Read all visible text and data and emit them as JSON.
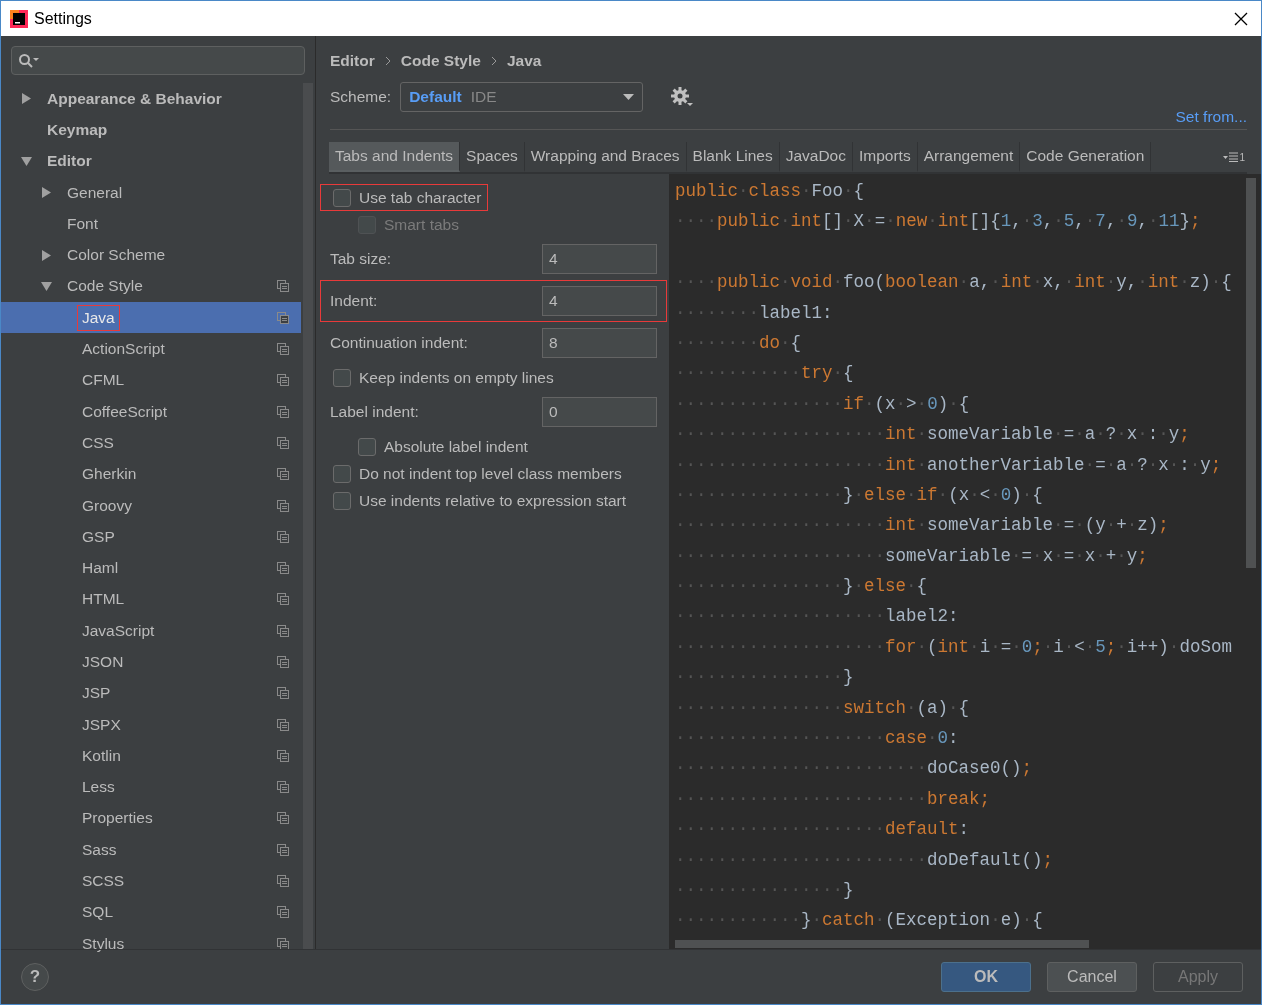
{
  "window": {
    "title": "Settings"
  },
  "sidebar": {
    "tree": [
      {
        "label": "Appearance & Behavior",
        "expanded": false,
        "selected": false
      },
      {
        "label": "Keymap",
        "selected": false
      },
      {
        "label": "Editor",
        "expanded": true,
        "selected": false,
        "children": [
          {
            "label": "General",
            "expanded": false,
            "selected": false,
            "copy_icon": false
          },
          {
            "label": "Font",
            "selected": false,
            "copy_icon": false
          },
          {
            "label": "Color Scheme",
            "expanded": false,
            "selected": false,
            "copy_icon": false
          },
          {
            "label": "Code Style",
            "expanded": true,
            "selected": false,
            "copy_icon": true,
            "children": [
              {
                "label": "Java",
                "selected": true,
                "copy_icon": true,
                "highlighted": true
              },
              {
                "label": "ActionScript",
                "selected": false,
                "copy_icon": true,
                "highlighted": false
              },
              {
                "label": "CFML",
                "selected": false,
                "copy_icon": true,
                "highlighted": false
              },
              {
                "label": "CoffeeScript",
                "selected": false,
                "copy_icon": true,
                "highlighted": false
              },
              {
                "label": "CSS",
                "selected": false,
                "copy_icon": true,
                "highlighted": false
              },
              {
                "label": "Gherkin",
                "selected": false,
                "copy_icon": true,
                "highlighted": false
              },
              {
                "label": "Groovy",
                "selected": false,
                "copy_icon": true,
                "highlighted": false
              },
              {
                "label": "GSP",
                "selected": false,
                "copy_icon": true,
                "highlighted": false
              },
              {
                "label": "Haml",
                "selected": false,
                "copy_icon": true,
                "highlighted": false
              },
              {
                "label": "HTML",
                "selected": false,
                "copy_icon": true,
                "highlighted": false
              },
              {
                "label": "JavaScript",
                "selected": false,
                "copy_icon": true,
                "highlighted": false
              },
              {
                "label": "JSON",
                "selected": false,
                "copy_icon": true,
                "highlighted": false
              },
              {
                "label": "JSP",
                "selected": false,
                "copy_icon": true,
                "highlighted": false
              },
              {
                "label": "JSPX",
                "selected": false,
                "copy_icon": true,
                "highlighted": false
              },
              {
                "label": "Kotlin",
                "selected": false,
                "copy_icon": true,
                "highlighted": false
              },
              {
                "label": "Less",
                "selected": false,
                "copy_icon": true,
                "highlighted": false
              },
              {
                "label": "Properties",
                "selected": false,
                "copy_icon": true,
                "highlighted": false
              },
              {
                "label": "Sass",
                "selected": false,
                "copy_icon": true,
                "highlighted": false
              },
              {
                "label": "SCSS",
                "selected": false,
                "copy_icon": true,
                "highlighted": false
              },
              {
                "label": "SQL",
                "selected": false,
                "copy_icon": true,
                "highlighted": false
              },
              {
                "label": "Stylus",
                "selected": false,
                "copy_icon": true,
                "highlighted": false
              }
            ]
          }
        ]
      }
    ]
  },
  "breadcrumb": [
    "Editor",
    "Code Style",
    "Java"
  ],
  "scheme": {
    "label": "Scheme:",
    "name": "Default",
    "type": "IDE"
  },
  "set_from": "Set from...",
  "tabs": [
    {
      "label": "Tabs and Indents",
      "selected": true
    },
    {
      "label": "Spaces",
      "selected": false
    },
    {
      "label": "Wrapping and Braces",
      "selected": false
    },
    {
      "label": "Blank Lines",
      "selected": false
    },
    {
      "label": "JavaDoc",
      "selected": false
    },
    {
      "label": "Imports",
      "selected": false
    },
    {
      "label": "Arrangement",
      "selected": false
    },
    {
      "label": "Code Generation",
      "selected": false
    }
  ],
  "tabs_overflow_count": "1",
  "options": [
    {
      "kind": "checkbox",
      "label": "Use tab character",
      "checked": false,
      "disabled": false,
      "nested": false,
      "highlighted": true
    },
    {
      "kind": "checkbox",
      "label": "Smart tabs",
      "checked": false,
      "disabled": true,
      "nested": true,
      "highlighted": false
    },
    {
      "kind": "number",
      "label": "Tab size:",
      "value": "4",
      "highlighted": false
    },
    {
      "kind": "number",
      "label": "Indent:",
      "value": "4",
      "highlighted": true
    },
    {
      "kind": "number",
      "label": "Continuation indent:",
      "value": "8",
      "highlighted": false
    },
    {
      "kind": "checkbox",
      "label": "Keep indents on empty lines",
      "checked": false,
      "disabled": false,
      "nested": false,
      "highlighted": false
    },
    {
      "kind": "number",
      "label": "Label indent:",
      "value": "0",
      "highlighted": false
    },
    {
      "kind": "checkbox",
      "label": "Absolute label indent",
      "checked": false,
      "disabled": false,
      "nested": true,
      "highlighted": false
    },
    {
      "kind": "checkbox",
      "label": "Do not indent top level class members",
      "checked": false,
      "disabled": false,
      "nested": false,
      "highlighted": false
    },
    {
      "kind": "checkbox",
      "label": "Use indents relative to expression start",
      "checked": false,
      "disabled": false,
      "nested": false,
      "highlighted": false
    }
  ],
  "code_preview": [
    {
      "kind": "code",
      "tokens": [
        {
          "kind": "keyword",
          "text": "public"
        },
        {
          "kind": "space",
          "text": "·"
        },
        {
          "kind": "keyword",
          "text": "class"
        },
        {
          "kind": "space",
          "text": "·"
        },
        {
          "kind": "plain",
          "text": "Foo"
        },
        {
          "kind": "space",
          "text": "·"
        },
        {
          "kind": "plain",
          "text": "{"
        }
      ]
    },
    {
      "kind": "code",
      "tokens": [
        {
          "kind": "space",
          "text": "····"
        },
        {
          "kind": "keyword",
          "text": "public"
        },
        {
          "kind": "space",
          "text": "·"
        },
        {
          "kind": "keyword",
          "text": "int"
        },
        {
          "kind": "plain",
          "text": "[]"
        },
        {
          "kind": "space",
          "text": "·"
        },
        {
          "kind": "plain",
          "text": "X"
        },
        {
          "kind": "space",
          "text": "·"
        },
        {
          "kind": "plain",
          "text": "="
        },
        {
          "kind": "space",
          "text": "·"
        },
        {
          "kind": "keyword",
          "text": "new"
        },
        {
          "kind": "space",
          "text": "·"
        },
        {
          "kind": "keyword",
          "text": "int"
        },
        {
          "kind": "plain",
          "text": "[]{"
        },
        {
          "kind": "number",
          "text": "1"
        },
        {
          "kind": "plain",
          "text": ","
        },
        {
          "kind": "space",
          "text": "·"
        },
        {
          "kind": "number",
          "text": "3"
        },
        {
          "kind": "plain",
          "text": ","
        },
        {
          "kind": "space",
          "text": "·"
        },
        {
          "kind": "number",
          "text": "5"
        },
        {
          "kind": "plain",
          "text": ","
        },
        {
          "kind": "space",
          "text": "·"
        },
        {
          "kind": "number",
          "text": "7"
        },
        {
          "kind": "plain",
          "text": ","
        },
        {
          "kind": "space",
          "text": "·"
        },
        {
          "kind": "number",
          "text": "9"
        },
        {
          "kind": "plain",
          "text": ","
        },
        {
          "kind": "space",
          "text": "·"
        },
        {
          "kind": "number",
          "text": "11"
        },
        {
          "kind": "plain",
          "text": "}"
        },
        {
          "kind": "keyword",
          "text": ";"
        }
      ]
    },
    {
      "kind": "blank"
    },
    {
      "kind": "code",
      "tokens": [
        {
          "kind": "space",
          "text": "····"
        },
        {
          "kind": "keyword",
          "text": "public"
        },
        {
          "kind": "space",
          "text": "·"
        },
        {
          "kind": "keyword",
          "text": "void"
        },
        {
          "kind": "space",
          "text": "·"
        },
        {
          "kind": "plain",
          "text": "foo("
        },
        {
          "kind": "keyword",
          "text": "boolean"
        },
        {
          "kind": "space",
          "text": "·"
        },
        {
          "kind": "plain",
          "text": "a,"
        },
        {
          "kind": "space",
          "text": "·"
        },
        {
          "kind": "keyword",
          "text": "int"
        },
        {
          "kind": "space",
          "text": "·"
        },
        {
          "kind": "plain",
          "text": "x,"
        },
        {
          "kind": "space",
          "text": "·"
        },
        {
          "kind": "keyword",
          "text": "int"
        },
        {
          "kind": "space",
          "text": "·"
        },
        {
          "kind": "plain",
          "text": "y,"
        },
        {
          "kind": "space",
          "text": "·"
        },
        {
          "kind": "keyword",
          "text": "int"
        },
        {
          "kind": "space",
          "text": "·"
        },
        {
          "kind": "plain",
          "text": "z)"
        },
        {
          "kind": "space",
          "text": "·"
        },
        {
          "kind": "plain",
          "text": "{"
        }
      ]
    },
    {
      "kind": "code",
      "tokens": [
        {
          "kind": "space",
          "text": "········"
        },
        {
          "kind": "plain",
          "text": "label1:"
        }
      ]
    },
    {
      "kind": "code",
      "tokens": [
        {
          "kind": "space",
          "text": "········"
        },
        {
          "kind": "keyword",
          "text": "do"
        },
        {
          "kind": "space",
          "text": "·"
        },
        {
          "kind": "plain",
          "text": "{"
        }
      ]
    },
    {
      "kind": "code",
      "tokens": [
        {
          "kind": "space",
          "text": "············"
        },
        {
          "kind": "keyword",
          "text": "try"
        },
        {
          "kind": "space",
          "text": "·"
        },
        {
          "kind": "plain",
          "text": "{"
        }
      ]
    },
    {
      "kind": "code",
      "tokens": [
        {
          "kind": "space",
          "text": "················"
        },
        {
          "kind": "keyword",
          "text": "if"
        },
        {
          "kind": "space",
          "text": "·"
        },
        {
          "kind": "plain",
          "text": "(x"
        },
        {
          "kind": "space",
          "text": "·"
        },
        {
          "kind": "plain",
          "text": ">"
        },
        {
          "kind": "space",
          "text": "·"
        },
        {
          "kind": "number",
          "text": "0"
        },
        {
          "kind": "plain",
          "text": ")"
        },
        {
          "kind": "space",
          "text": "·"
        },
        {
          "kind": "plain",
          "text": "{"
        }
      ]
    },
    {
      "kind": "code",
      "tokens": [
        {
          "kind": "space",
          "text": "····················"
        },
        {
          "kind": "keyword",
          "text": "int"
        },
        {
          "kind": "space",
          "text": "·"
        },
        {
          "kind": "plain",
          "text": "someVariable"
        },
        {
          "kind": "space",
          "text": "·"
        },
        {
          "kind": "plain",
          "text": "="
        },
        {
          "kind": "space",
          "text": "·"
        },
        {
          "kind": "plain",
          "text": "a"
        },
        {
          "kind": "space",
          "text": "·"
        },
        {
          "kind": "plain",
          "text": "?"
        },
        {
          "kind": "space",
          "text": "·"
        },
        {
          "kind": "plain",
          "text": "x"
        },
        {
          "kind": "space",
          "text": "·"
        },
        {
          "kind": "plain",
          "text": ":"
        },
        {
          "kind": "space",
          "text": "·"
        },
        {
          "kind": "plain",
          "text": "y"
        },
        {
          "kind": "keyword",
          "text": ";"
        }
      ]
    },
    {
      "kind": "code",
      "tokens": [
        {
          "kind": "space",
          "text": "····················"
        },
        {
          "kind": "keyword",
          "text": "int"
        },
        {
          "kind": "space",
          "text": "·"
        },
        {
          "kind": "plain",
          "text": "anotherVariable"
        },
        {
          "kind": "space",
          "text": "·"
        },
        {
          "kind": "plain",
          "text": "="
        },
        {
          "kind": "space",
          "text": "·"
        },
        {
          "kind": "plain",
          "text": "a"
        },
        {
          "kind": "space",
          "text": "·"
        },
        {
          "kind": "plain",
          "text": "?"
        },
        {
          "kind": "space",
          "text": "·"
        },
        {
          "kind": "plain",
          "text": "x"
        },
        {
          "kind": "space",
          "text": "·"
        },
        {
          "kind": "plain",
          "text": ":"
        },
        {
          "kind": "space",
          "text": "·"
        },
        {
          "kind": "plain",
          "text": "y"
        },
        {
          "kind": "keyword",
          "text": ";"
        }
      ]
    },
    {
      "kind": "code",
      "tokens": [
        {
          "kind": "space",
          "text": "················"
        },
        {
          "kind": "plain",
          "text": "}"
        },
        {
          "kind": "space",
          "text": "·"
        },
        {
          "kind": "keyword",
          "text": "else"
        },
        {
          "kind": "space",
          "text": "·"
        },
        {
          "kind": "keyword",
          "text": "if"
        },
        {
          "kind": "space",
          "text": "·"
        },
        {
          "kind": "plain",
          "text": "(x"
        },
        {
          "kind": "space",
          "text": "·"
        },
        {
          "kind": "plain",
          "text": "<"
        },
        {
          "kind": "space",
          "text": "·"
        },
        {
          "kind": "number",
          "text": "0"
        },
        {
          "kind": "plain",
          "text": ")"
        },
        {
          "kind": "space",
          "text": "·"
        },
        {
          "kind": "plain",
          "text": "{"
        }
      ]
    },
    {
      "kind": "code",
      "tokens": [
        {
          "kind": "space",
          "text": "····················"
        },
        {
          "kind": "keyword",
          "text": "int"
        },
        {
          "kind": "space",
          "text": "·"
        },
        {
          "kind": "plain",
          "text": "someVariable"
        },
        {
          "kind": "space",
          "text": "·"
        },
        {
          "kind": "plain",
          "text": "="
        },
        {
          "kind": "space",
          "text": "·"
        },
        {
          "kind": "plain",
          "text": "(y"
        },
        {
          "kind": "space",
          "text": "·"
        },
        {
          "kind": "plain",
          "text": "+"
        },
        {
          "kind": "space",
          "text": "·"
        },
        {
          "kind": "plain",
          "text": "z)"
        },
        {
          "kind": "keyword",
          "text": ";"
        }
      ]
    },
    {
      "kind": "code",
      "tokens": [
        {
          "kind": "space",
          "text": "····················"
        },
        {
          "kind": "plain",
          "text": "someVariable"
        },
        {
          "kind": "space",
          "text": "·"
        },
        {
          "kind": "plain",
          "text": "="
        },
        {
          "kind": "space",
          "text": "·"
        },
        {
          "kind": "plain",
          "text": "x"
        },
        {
          "kind": "space",
          "text": "·"
        },
        {
          "kind": "plain",
          "text": "="
        },
        {
          "kind": "space",
          "text": "·"
        },
        {
          "kind": "plain",
          "text": "x"
        },
        {
          "kind": "space",
          "text": "·"
        },
        {
          "kind": "plain",
          "text": "+"
        },
        {
          "kind": "space",
          "text": "·"
        },
        {
          "kind": "plain",
          "text": "y"
        },
        {
          "kind": "keyword",
          "text": ";"
        }
      ]
    },
    {
      "kind": "code",
      "tokens": [
        {
          "kind": "space",
          "text": "················"
        },
        {
          "kind": "plain",
          "text": "}"
        },
        {
          "kind": "space",
          "text": "·"
        },
        {
          "kind": "keyword",
          "text": "else"
        },
        {
          "kind": "space",
          "text": "·"
        },
        {
          "kind": "plain",
          "text": "{"
        }
      ]
    },
    {
      "kind": "code",
      "tokens": [
        {
          "kind": "space",
          "text": "····················"
        },
        {
          "kind": "plain",
          "text": "label2:"
        }
      ]
    },
    {
      "kind": "code",
      "tokens": [
        {
          "kind": "space",
          "text": "····················"
        },
        {
          "kind": "keyword",
          "text": "for"
        },
        {
          "kind": "space",
          "text": "·"
        },
        {
          "kind": "plain",
          "text": "("
        },
        {
          "kind": "keyword",
          "text": "int"
        },
        {
          "kind": "space",
          "text": "·"
        },
        {
          "kind": "plain",
          "text": "i"
        },
        {
          "kind": "space",
          "text": "·"
        },
        {
          "kind": "plain",
          "text": "="
        },
        {
          "kind": "space",
          "text": "·"
        },
        {
          "kind": "number",
          "text": "0"
        },
        {
          "kind": "keyword",
          "text": ";"
        },
        {
          "kind": "space",
          "text": "·"
        },
        {
          "kind": "plain",
          "text": "i"
        },
        {
          "kind": "space",
          "text": "·"
        },
        {
          "kind": "plain",
          "text": "<"
        },
        {
          "kind": "space",
          "text": "·"
        },
        {
          "kind": "number",
          "text": "5"
        },
        {
          "kind": "keyword",
          "text": ";"
        },
        {
          "kind": "space",
          "text": "·"
        },
        {
          "kind": "plain",
          "text": "i++)"
        },
        {
          "kind": "space",
          "text": "·"
        },
        {
          "kind": "plain",
          "text": "doSom"
        }
      ]
    },
    {
      "kind": "code",
      "tokens": [
        {
          "kind": "space",
          "text": "················"
        },
        {
          "kind": "plain",
          "text": "}"
        }
      ]
    },
    {
      "kind": "code",
      "tokens": [
        {
          "kind": "space",
          "text": "················"
        },
        {
          "kind": "keyword",
          "text": "switch"
        },
        {
          "kind": "space",
          "text": "·"
        },
        {
          "kind": "plain",
          "text": "(a)"
        },
        {
          "kind": "space",
          "text": "·"
        },
        {
          "kind": "plain",
          "text": "{"
        }
      ]
    },
    {
      "kind": "code",
      "tokens": [
        {
          "kind": "space",
          "text": "····················"
        },
        {
          "kind": "keyword",
          "text": "case"
        },
        {
          "kind": "space",
          "text": "·"
        },
        {
          "kind": "number",
          "text": "0"
        },
        {
          "kind": "plain",
          "text": ":"
        }
      ]
    },
    {
      "kind": "code",
      "tokens": [
        {
          "kind": "space",
          "text": "························"
        },
        {
          "kind": "plain",
          "text": "doCase0()"
        },
        {
          "kind": "keyword",
          "text": ";"
        }
      ]
    },
    {
      "kind": "code",
      "tokens": [
        {
          "kind": "space",
          "text": "························"
        },
        {
          "kind": "keyword",
          "text": "break;"
        }
      ]
    },
    {
      "kind": "code",
      "tokens": [
        {
          "kind": "space",
          "text": "····················"
        },
        {
          "kind": "keyword",
          "text": "default"
        },
        {
          "kind": "plain",
          "text": ":"
        }
      ]
    },
    {
      "kind": "code",
      "tokens": [
        {
          "kind": "space",
          "text": "························"
        },
        {
          "kind": "plain",
          "text": "doDefault()"
        },
        {
          "kind": "keyword",
          "text": ";"
        }
      ]
    },
    {
      "kind": "code",
      "tokens": [
        {
          "kind": "space",
          "text": "················"
        },
        {
          "kind": "plain",
          "text": "}"
        }
      ]
    },
    {
      "kind": "code",
      "tokens": [
        {
          "kind": "space",
          "text": "············"
        },
        {
          "kind": "plain",
          "text": "}"
        },
        {
          "kind": "space",
          "text": "·"
        },
        {
          "kind": "keyword",
          "text": "catch"
        },
        {
          "kind": "space",
          "text": "·"
        },
        {
          "kind": "plain",
          "text": "(Exception"
        },
        {
          "kind": "space",
          "text": "·"
        },
        {
          "kind": "plain",
          "text": "e)"
        },
        {
          "kind": "space",
          "text": "·"
        },
        {
          "kind": "plain",
          "text": "{"
        }
      ]
    }
  ],
  "help_label": "?",
  "buttons": [
    {
      "label": "OK",
      "kind": "primary",
      "disabled": false
    },
    {
      "label": "Cancel",
      "kind": "normal",
      "disabled": false
    },
    {
      "label": "Apply",
      "kind": "normal",
      "disabled": true
    }
  ]
}
